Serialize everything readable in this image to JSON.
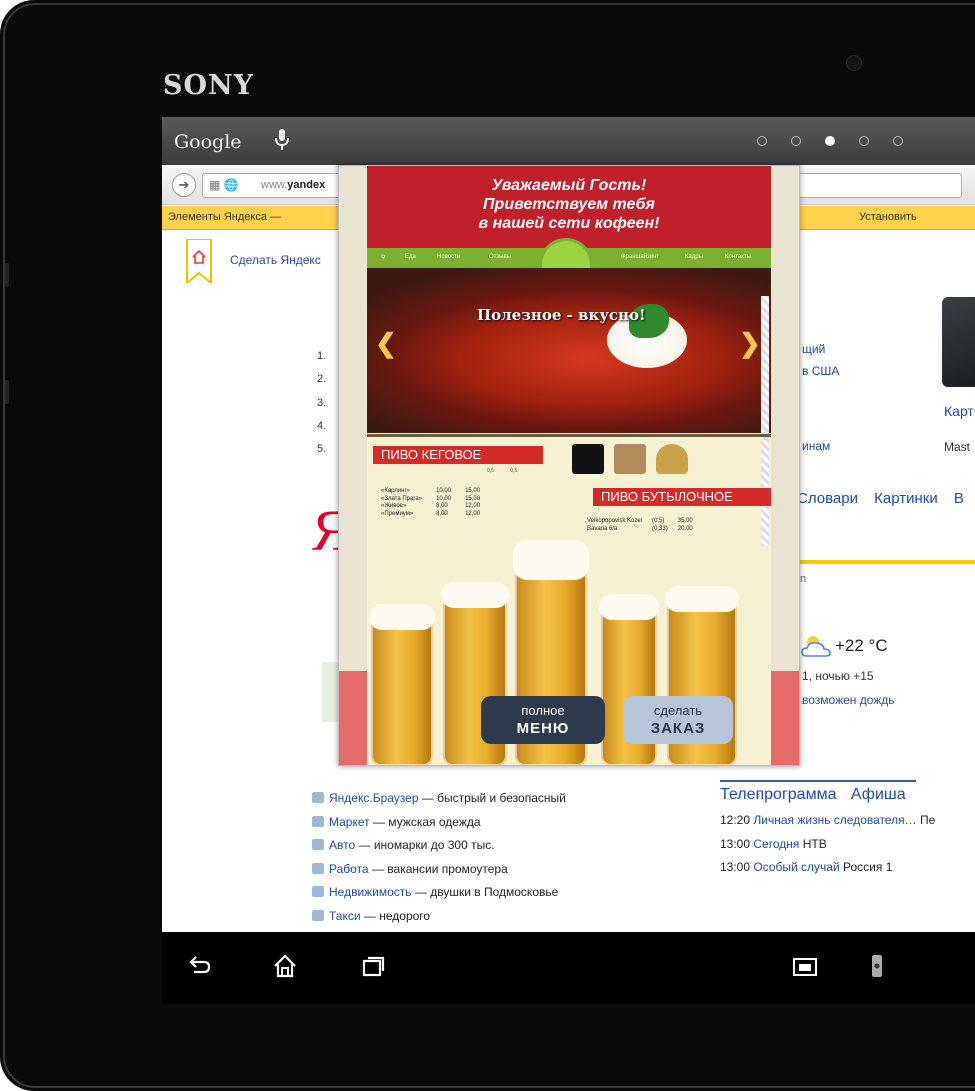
{
  "device": {
    "brand": "SONY"
  },
  "statusbar": {
    "google_label": "Google",
    "page_dots": 5,
    "active_dot": 3
  },
  "browser": {
    "url_prefix": "www.",
    "url_domain": "yandex"
  },
  "yandex_bar": {
    "left": "Элементы Яндекса —",
    "install": "Установить"
  },
  "home": {
    "label": "Сделать Яндекс"
  },
  "news": {
    "numbers": [
      "1.",
      "2.",
      "3.",
      "4.",
      "5."
    ],
    "fragment_1": "щий",
    "fragment_2": "в США",
    "fragment_5": "инам"
  },
  "card": {
    "title": "Карт",
    "subtitle": "Mast"
  },
  "services": [
    "Словари",
    "Картинки",
    "В"
  ],
  "ylogo_fragment": "Я",
  "small_n": "n",
  "weather": {
    "temp": "+22 °C",
    "night": "1,  ночью +15",
    "rain": "возможен дождь"
  },
  "promo": [
    {
      "link": "Яндекс.Браузер",
      "rest": " — быстрый и безопасный"
    },
    {
      "link": "Маркет",
      "rest": " — мужская одежда"
    },
    {
      "link": "Авто",
      "rest": " — иномарки до 300 тыс."
    },
    {
      "link": "Работа",
      "rest": " — вакансии промоутера"
    },
    {
      "link": "Недвижимость",
      "rest": " — двушки в Подмосковье"
    },
    {
      "link": "Такси",
      "rest": " — недорого"
    }
  ],
  "tv": {
    "tabs": [
      "Телепрограмма",
      "Афиша"
    ],
    "rows": [
      {
        "time": "12:20",
        "title": "Личная жизнь следователя…",
        "channel": "Пе"
      },
      {
        "time": "13:00",
        "title": "Сегодня",
        "channel": "НТВ"
      },
      {
        "time": "13:00",
        "title": "Особый случай",
        "channel": "Россия 1"
      }
    ]
  },
  "popup": {
    "greeting": [
      "Уважаемый Гость!",
      "Приветствуем тебя",
      "в нашей сети кофеен!"
    ],
    "nav": [
      "Еда",
      "Новости",
      "Отзывы",
      "Франшайзинг",
      "Кадры",
      "Контакты"
    ],
    "slide_caption": "Полезное - вкусно!",
    "keg_title": "ПИВО КЕГОВОЕ",
    "keg_volumes": "0,5 0,5",
    "keg_rows": [
      {
        "name": "«Карлинг»",
        "p1": "10,00",
        "p2": "15,00"
      },
      {
        "name": "«Злата Прага»",
        "p1": "10,00",
        "p2": "15,00"
      },
      {
        "name": "«Живое»",
        "p1": "8,00",
        "p2": "12,00"
      },
      {
        "name": "«Премиум»",
        "p1": "8,00",
        "p2": "12,00"
      }
    ],
    "bottle_title": "ПИВО БУТЫЛОЧНОЕ",
    "bottle_rows": [
      {
        "name": "Velkopopovisk Kozel",
        "vol": "(0,5)",
        "price": "35,00"
      },
      {
        "name": "Bavaria 6/а",
        "vol": "(0,33)",
        "price": "20,00"
      }
    ],
    "logos": [
      "Carling",
      "Zlata Praha",
      "Obolon"
    ],
    "menu_button": {
      "line1": "полное",
      "line2": "МЕНЮ"
    },
    "order_button": {
      "line1": "сделать",
      "line2": "ЗАКАЗ"
    }
  },
  "colors": {
    "yandex_yellow": "#ffd24a",
    "popup_red": "#c0202a",
    "link_blue": "#1a4fa3",
    "menu_btn": "#2d3a4d",
    "order_btn": "#b6c6d8"
  }
}
